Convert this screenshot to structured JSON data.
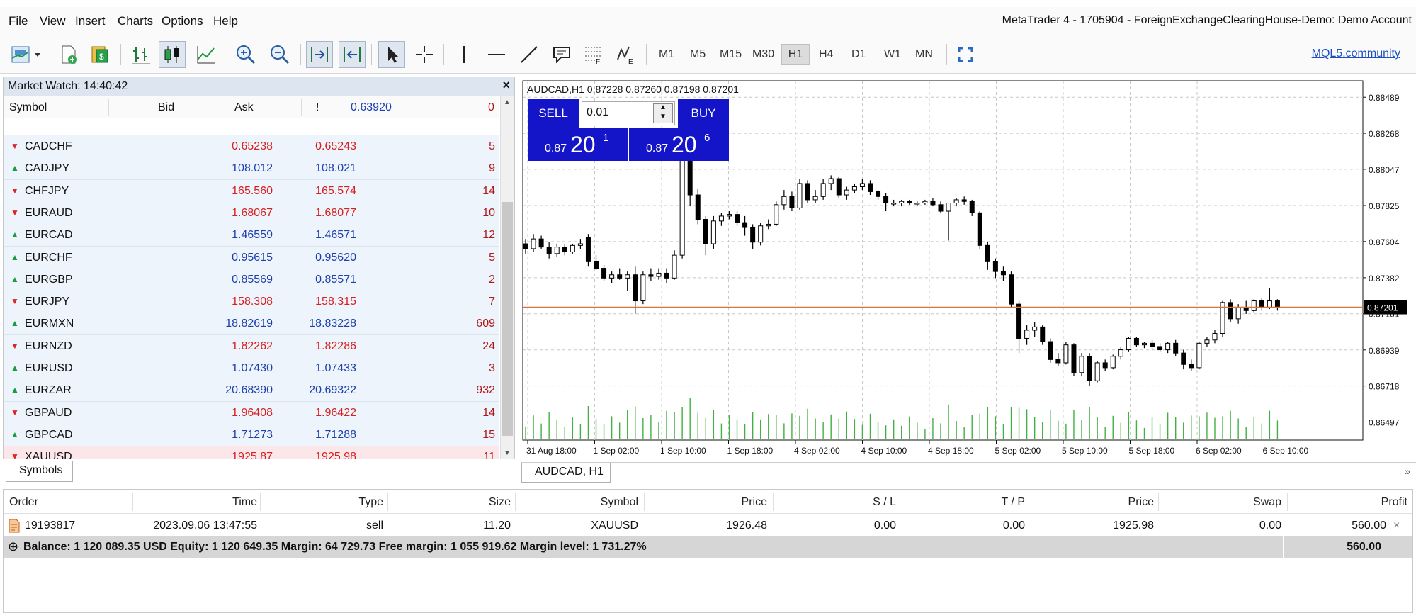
{
  "menu": [
    "File",
    "View",
    "Insert",
    "Charts",
    "Options",
    "Help"
  ],
  "window_title": "MetaTrader 4 - 1705904 - ForeignExchangeClearingHouse-Demo: Demo Account",
  "toolbar": {
    "timeframes": [
      "M1",
      "M5",
      "M15",
      "M30",
      "H1",
      "H4",
      "D1",
      "W1",
      "MN"
    ],
    "active_timeframe": "H1",
    "community_link": "MQL5.community"
  },
  "market_watch": {
    "title": "Market Watch: 14:40:42",
    "columns": {
      "symbol": "Symbol",
      "bid": "Bid",
      "ask": "Ask",
      "spread": "!"
    },
    "partial_row": {
      "ask": "0.63920",
      "spread": "0"
    },
    "rows": [
      {
        "symbol": "CADCHF",
        "bid": "0.65238",
        "ask": "0.65243",
        "spread": "5",
        "dir": "down"
      },
      {
        "symbol": "CADJPY",
        "bid": "108.012",
        "ask": "108.021",
        "spread": "9",
        "dir": "up"
      },
      {
        "symbol": "CHFJPY",
        "bid": "165.560",
        "ask": "165.574",
        "spread": "14",
        "dir": "down"
      },
      {
        "symbol": "EURAUD",
        "bid": "1.68067",
        "ask": "1.68077",
        "spread": "10",
        "dir": "down"
      },
      {
        "symbol": "EURCAD",
        "bid": "1.46559",
        "ask": "1.46571",
        "spread": "12",
        "dir": "up"
      },
      {
        "symbol": "EURCHF",
        "bid": "0.95615",
        "ask": "0.95620",
        "spread": "5",
        "dir": "up"
      },
      {
        "symbol": "EURGBP",
        "bid": "0.85569",
        "ask": "0.85571",
        "spread": "2",
        "dir": "up"
      },
      {
        "symbol": "EURJPY",
        "bid": "158.308",
        "ask": "158.315",
        "spread": "7",
        "dir": "down"
      },
      {
        "symbol": "EURMXN",
        "bid": "18.82619",
        "ask": "18.83228",
        "spread": "609",
        "dir": "up"
      },
      {
        "symbol": "EURNZD",
        "bid": "1.82262",
        "ask": "1.82286",
        "spread": "24",
        "dir": "down"
      },
      {
        "symbol": "EURUSD",
        "bid": "1.07430",
        "ask": "1.07433",
        "spread": "3",
        "dir": "up"
      },
      {
        "symbol": "EURZAR",
        "bid": "20.68390",
        "ask": "20.69322",
        "spread": "932",
        "dir": "up"
      },
      {
        "symbol": "GBPAUD",
        "bid": "1.96408",
        "ask": "1.96422",
        "spread": "14",
        "dir": "down"
      },
      {
        "symbol": "GBPCAD",
        "bid": "1.71273",
        "ask": "1.71288",
        "spread": "15",
        "dir": "up"
      },
      {
        "symbol": "XAUUSD",
        "bid": "1925.87",
        "ask": "1925.98",
        "spread": "11",
        "dir": "down",
        "selected": true
      }
    ],
    "tab": "Symbols"
  },
  "chart": {
    "header": "AUDCAD,H1  0.87228 0.87260 0.87198 0.87201",
    "tab": "AUDCAD, H1",
    "more": "»"
  },
  "trade_panel": {
    "sell_label": "SELL",
    "buy_label": "BUY",
    "lot": "0.01",
    "sell_price": {
      "prefix": "0.87",
      "big": "20",
      "sup": "1"
    },
    "buy_price": {
      "prefix": "0.87",
      "big": "20",
      "sup": "6"
    }
  },
  "chart_data": {
    "type": "candlestick",
    "title": "AUDCAD,H1",
    "y_ticks": [
      "0.88489",
      "0.88268",
      "0.88047",
      "0.87825",
      "0.87604",
      "0.87382",
      "0.87161",
      "0.86939",
      "0.86718",
      "0.86497"
    ],
    "x_ticks": [
      "31 Aug 18:00",
      "1 Sep 02:00",
      "1 Sep 10:00",
      "1 Sep 18:00",
      "4 Sep 02:00",
      "4 Sep 10:00",
      "4 Sep 18:00",
      "5 Sep 02:00",
      "5 Sep 10:00",
      "5 Sep 18:00",
      "6 Sep 02:00",
      "6 Sep 10:00"
    ],
    "ylim": [
      0.86386,
      0.8859
    ],
    "current_price": "0.87201",
    "current_price_value": 0.87201,
    "grid": true,
    "candles": [
      [
        0.8759,
        0.8762,
        0.8753,
        0.8756
      ],
      [
        0.8756,
        0.8765,
        0.8754,
        0.8762
      ],
      [
        0.8762,
        0.8764,
        0.8756,
        0.8757
      ],
      [
        0.8757,
        0.876,
        0.875,
        0.8753
      ],
      [
        0.8753,
        0.8759,
        0.8751,
        0.8757
      ],
      [
        0.8757,
        0.8759,
        0.8752,
        0.8754
      ],
      [
        0.8754,
        0.8759,
        0.8753,
        0.8758
      ],
      [
        0.8758,
        0.8762,
        0.8756,
        0.8759
      ],
      [
        0.8763,
        0.8765,
        0.8745,
        0.8748
      ],
      [
        0.8748,
        0.8752,
        0.8743,
        0.8744
      ],
      [
        0.8744,
        0.8746,
        0.8736,
        0.8738
      ],
      [
        0.8738,
        0.8742,
        0.8735,
        0.874
      ],
      [
        0.874,
        0.8744,
        0.8737,
        0.8738
      ],
      [
        0.8738,
        0.8742,
        0.873,
        0.874
      ],
      [
        0.874,
        0.8745,
        0.8716,
        0.8724
      ],
      [
        0.8724,
        0.8742,
        0.8722,
        0.874
      ],
      [
        0.874,
        0.8744,
        0.8736,
        0.8739
      ],
      [
        0.8739,
        0.8744,
        0.8737,
        0.8741
      ],
      [
        0.8741,
        0.8744,
        0.8735,
        0.8738
      ],
      [
        0.8738,
        0.8755,
        0.8737,
        0.8752
      ],
      [
        0.8752,
        0.883,
        0.875,
        0.8825
      ],
      [
        0.8825,
        0.8834,
        0.8782,
        0.8789
      ],
      [
        0.8789,
        0.8793,
        0.8771,
        0.8774
      ],
      [
        0.8774,
        0.8776,
        0.8752,
        0.8759
      ],
      [
        0.8759,
        0.8776,
        0.8756,
        0.8773
      ],
      [
        0.8773,
        0.8778,
        0.877,
        0.8776
      ],
      [
        0.8776,
        0.8779,
        0.8774,
        0.8777
      ],
      [
        0.8777,
        0.8779,
        0.877,
        0.8772
      ],
      [
        0.8772,
        0.8776,
        0.8764,
        0.8769
      ],
      [
        0.8769,
        0.8771,
        0.8756,
        0.876
      ],
      [
        0.876,
        0.8772,
        0.8758,
        0.877
      ],
      [
        0.877,
        0.8774,
        0.8768,
        0.8771
      ],
      [
        0.8771,
        0.8785,
        0.877,
        0.8783
      ],
      [
        0.8783,
        0.8792,
        0.878,
        0.8788
      ],
      [
        0.8788,
        0.8791,
        0.8779,
        0.8781
      ],
      [
        0.8781,
        0.8799,
        0.878,
        0.8796
      ],
      [
        0.8796,
        0.8798,
        0.8784,
        0.8786
      ],
      [
        0.8786,
        0.8792,
        0.8784,
        0.8788
      ],
      [
        0.8788,
        0.8799,
        0.8786,
        0.8796
      ],
      [
        0.8796,
        0.8801,
        0.8792,
        0.8799
      ],
      [
        0.8799,
        0.88,
        0.8787,
        0.8789
      ],
      [
        0.8789,
        0.8794,
        0.8786,
        0.8792
      ],
      [
        0.8792,
        0.8796,
        0.879,
        0.8794
      ],
      [
        0.8794,
        0.8799,
        0.8792,
        0.8796
      ],
      [
        0.8796,
        0.8798,
        0.8789,
        0.8791
      ],
      [
        0.8791,
        0.8792,
        0.8786,
        0.8788
      ],
      [
        0.8788,
        0.879,
        0.8779,
        0.8784
      ],
      [
        0.8784,
        0.8786,
        0.8782,
        0.8784
      ],
      [
        0.8784,
        0.8786,
        0.8782,
        0.8785
      ],
      [
        0.8785,
        0.8786,
        0.8783,
        0.8784
      ],
      [
        0.8784,
        0.8785,
        0.8782,
        0.8784
      ],
      [
        0.8784,
        0.8786,
        0.8783,
        0.8785
      ],
      [
        0.8785,
        0.8787,
        0.8782,
        0.8783
      ],
      [
        0.8783,
        0.8785,
        0.8778,
        0.8779
      ],
      [
        0.8779,
        0.8784,
        0.8761,
        0.8784
      ],
      [
        0.8784,
        0.8787,
        0.8782,
        0.8786
      ],
      [
        0.8786,
        0.8788,
        0.8783,
        0.8785
      ],
      [
        0.8785,
        0.8786,
        0.8776,
        0.8778
      ],
      [
        0.8778,
        0.8779,
        0.8756,
        0.8758
      ],
      [
        0.8758,
        0.876,
        0.8743,
        0.8748
      ],
      [
        0.8748,
        0.875,
        0.8738,
        0.8742
      ],
      [
        0.8742,
        0.8745,
        0.8736,
        0.874
      ],
      [
        0.874,
        0.8742,
        0.872,
        0.8722
      ],
      [
        0.8722,
        0.8724,
        0.8692,
        0.8701
      ],
      [
        0.8701,
        0.8709,
        0.8697,
        0.8706
      ],
      [
        0.8706,
        0.8711,
        0.8702,
        0.8708
      ],
      [
        0.8708,
        0.8709,
        0.8697,
        0.8699
      ],
      [
        0.8699,
        0.8701,
        0.8686,
        0.8688
      ],
      [
        0.8688,
        0.8692,
        0.8684,
        0.8686
      ],
      [
        0.8686,
        0.8699,
        0.8685,
        0.8697
      ],
      [
        0.8697,
        0.8698,
        0.8678,
        0.868
      ],
      [
        0.868,
        0.8692,
        0.8678,
        0.869
      ],
      [
        0.869,
        0.8692,
        0.8672,
        0.8675
      ],
      [
        0.8675,
        0.8687,
        0.8674,
        0.8686
      ],
      [
        0.8686,
        0.8688,
        0.8681,
        0.8683
      ],
      [
        0.8683,
        0.8691,
        0.8682,
        0.869
      ],
      [
        0.869,
        0.8696,
        0.8688,
        0.8694
      ],
      [
        0.8694,
        0.8702,
        0.8693,
        0.8701
      ],
      [
        0.8701,
        0.8702,
        0.8696,
        0.8697
      ],
      [
        0.8697,
        0.8699,
        0.8695,
        0.8698
      ],
      [
        0.8698,
        0.87,
        0.8694,
        0.8696
      ],
      [
        0.8696,
        0.8698,
        0.8693,
        0.8694
      ],
      [
        0.8694,
        0.8699,
        0.8692,
        0.8698
      ],
      [
        0.8698,
        0.87,
        0.869,
        0.8692
      ],
      [
        0.8692,
        0.8694,
        0.8682,
        0.8685
      ],
      [
        0.8685,
        0.8688,
        0.8681,
        0.8683
      ],
      [
        0.8683,
        0.8699,
        0.8682,
        0.8698
      ],
      [
        0.8698,
        0.8702,
        0.8696,
        0.87
      ],
      [
        0.87,
        0.8706,
        0.8698,
        0.8704
      ],
      [
        0.8704,
        0.8724,
        0.8702,
        0.8723
      ],
      [
        0.8723,
        0.8725,
        0.8711,
        0.8713
      ],
      [
        0.8713,
        0.8722,
        0.871,
        0.872
      ],
      [
        0.872,
        0.8724,
        0.8716,
        0.8718
      ],
      [
        0.8718,
        0.8725,
        0.8717,
        0.8724
      ],
      [
        0.8724,
        0.8726,
        0.8718,
        0.872
      ],
      [
        0.872,
        0.8732,
        0.8719,
        0.8724
      ],
      [
        0.8724,
        0.8725,
        0.8718,
        0.87201
      ]
    ]
  },
  "terminal": {
    "columns": [
      "Order",
      "Time",
      "Type",
      "Size",
      "Symbol",
      "Price",
      "S / L",
      "T / P",
      "Price",
      "Swap",
      "Profit"
    ],
    "order": {
      "id": "19193817",
      "time": "2023.09.06 13:47:55",
      "type": "sell",
      "size": "11.20",
      "symbol": "XAUUSD",
      "price": "1926.48",
      "sl": "0.00",
      "tp": "0.00",
      "current_price": "1925.98",
      "swap": "0.00",
      "profit": "560.00"
    },
    "balance_text": "Balance: 1 120 089.35 USD  Equity: 1 120 649.35  Margin: 64 729.73  Free margin: 1 055 919.62  Margin level: 1 731.27%",
    "balance_profit": "560.00",
    "close": "×",
    "expand": "⊕"
  },
  "colors": {
    "bid_down": "#d62020",
    "bid_up": "#1b3fb0",
    "spread": "#b01818",
    "trade_blue": "#1414c8",
    "price_line": "#d8743c"
  }
}
